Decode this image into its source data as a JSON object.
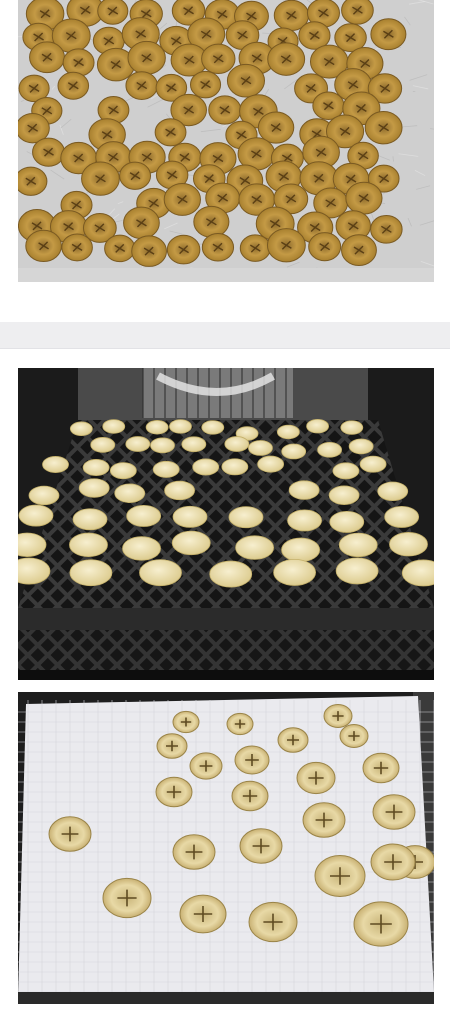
{
  "photos": [
    {
      "name": "dried-banana-chips-on-parchment",
      "alt": ""
    },
    {
      "name": "banana-slices-in-dehydrator-rack",
      "alt": ""
    },
    {
      "name": "banana-slices-on-paper-sheet",
      "alt": ""
    }
  ],
  "colors": {
    "page_bg": "#ffffff",
    "divider": "#eeeef0",
    "parchment": "#cfcfcf",
    "dried_chip": "#b98f3c",
    "fresh_slice": "#efe4b8",
    "rack_dark": "#1b1b1b"
  }
}
